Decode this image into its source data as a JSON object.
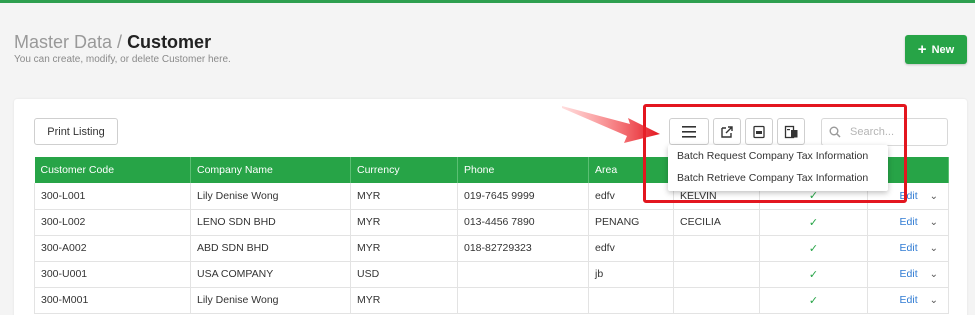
{
  "header": {
    "breadcrumb_parent": "Master Data /",
    "breadcrumb_current": "Customer",
    "subtitle": "You can create, modify, or delete Customer here.",
    "new_label": "New"
  },
  "toolbar": {
    "print_label": "Print Listing",
    "search_placeholder": "Search..."
  },
  "dropdown": {
    "items": [
      "Batch Request Company Tax Information",
      "Batch Retrieve Company Tax Information"
    ]
  },
  "table": {
    "columns": [
      "Customer Code",
      "Company Name",
      "Currency",
      "Phone",
      "Area",
      "",
      "",
      ""
    ],
    "edit_label": "Edit",
    "rows": [
      {
        "code": "300-L001",
        "name": "Lily Denise Wong",
        "currency": "MYR",
        "phone": "019-7645 9999",
        "area": "edfv",
        "agent": "KELVIN",
        "active": true
      },
      {
        "code": "300-L002",
        "name": "LENO SDN BHD",
        "currency": "MYR",
        "phone": "013-4456 7890",
        "area": "PENANG",
        "agent": "CECILIA",
        "active": true
      },
      {
        "code": "300-A002",
        "name": "ABD SDN BHD",
        "currency": "MYR",
        "phone": "018-82729323",
        "area": "edfv",
        "agent": "",
        "active": true
      },
      {
        "code": "300-U001",
        "name": "USA COMPANY",
        "currency": "USD",
        "phone": "",
        "area": "jb",
        "agent": "",
        "active": true
      },
      {
        "code": "300-M001",
        "name": "Lily Denise Wong",
        "currency": "MYR",
        "phone": "",
        "area": "",
        "agent": "",
        "active": true
      }
    ]
  },
  "colors": {
    "accent": "#27a447",
    "highlight": "#e3161f",
    "link": "#2f7bd3"
  },
  "icons": [
    "menu-icon",
    "export-icon",
    "xls-icon",
    "batch-tax-icon",
    "search-icon",
    "check-icon",
    "chevron-down-icon",
    "plus-icon"
  ]
}
